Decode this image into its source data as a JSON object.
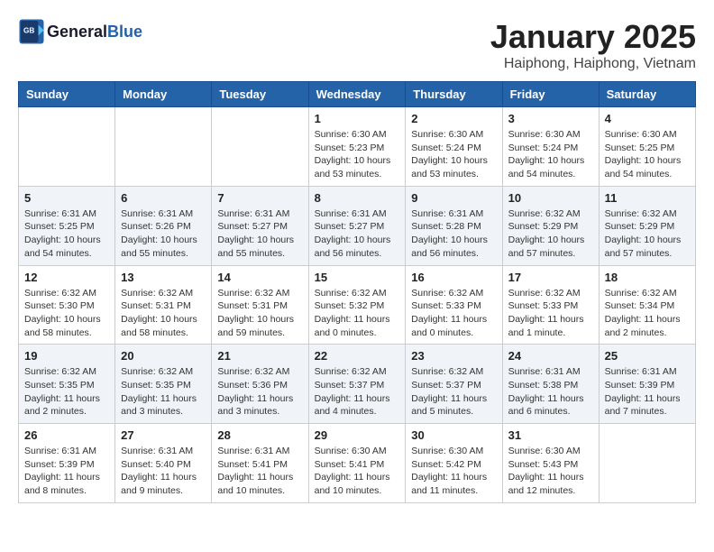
{
  "header": {
    "logo_line1": "General",
    "logo_line2": "Blue",
    "month": "January 2025",
    "location": "Haiphong, Haiphong, Vietnam"
  },
  "weekdays": [
    "Sunday",
    "Monday",
    "Tuesday",
    "Wednesday",
    "Thursday",
    "Friday",
    "Saturday"
  ],
  "weeks": [
    [
      {
        "day": "",
        "info": ""
      },
      {
        "day": "",
        "info": ""
      },
      {
        "day": "",
        "info": ""
      },
      {
        "day": "1",
        "info": "Sunrise: 6:30 AM\nSunset: 5:23 PM\nDaylight: 10 hours\nand 53 minutes."
      },
      {
        "day": "2",
        "info": "Sunrise: 6:30 AM\nSunset: 5:24 PM\nDaylight: 10 hours\nand 53 minutes."
      },
      {
        "day": "3",
        "info": "Sunrise: 6:30 AM\nSunset: 5:24 PM\nDaylight: 10 hours\nand 54 minutes."
      },
      {
        "day": "4",
        "info": "Sunrise: 6:30 AM\nSunset: 5:25 PM\nDaylight: 10 hours\nand 54 minutes."
      }
    ],
    [
      {
        "day": "5",
        "info": "Sunrise: 6:31 AM\nSunset: 5:25 PM\nDaylight: 10 hours\nand 54 minutes."
      },
      {
        "day": "6",
        "info": "Sunrise: 6:31 AM\nSunset: 5:26 PM\nDaylight: 10 hours\nand 55 minutes."
      },
      {
        "day": "7",
        "info": "Sunrise: 6:31 AM\nSunset: 5:27 PM\nDaylight: 10 hours\nand 55 minutes."
      },
      {
        "day": "8",
        "info": "Sunrise: 6:31 AM\nSunset: 5:27 PM\nDaylight: 10 hours\nand 56 minutes."
      },
      {
        "day": "9",
        "info": "Sunrise: 6:31 AM\nSunset: 5:28 PM\nDaylight: 10 hours\nand 56 minutes."
      },
      {
        "day": "10",
        "info": "Sunrise: 6:32 AM\nSunset: 5:29 PM\nDaylight: 10 hours\nand 57 minutes."
      },
      {
        "day": "11",
        "info": "Sunrise: 6:32 AM\nSunset: 5:29 PM\nDaylight: 10 hours\nand 57 minutes."
      }
    ],
    [
      {
        "day": "12",
        "info": "Sunrise: 6:32 AM\nSunset: 5:30 PM\nDaylight: 10 hours\nand 58 minutes."
      },
      {
        "day": "13",
        "info": "Sunrise: 6:32 AM\nSunset: 5:31 PM\nDaylight: 10 hours\nand 58 minutes."
      },
      {
        "day": "14",
        "info": "Sunrise: 6:32 AM\nSunset: 5:31 PM\nDaylight: 10 hours\nand 59 minutes."
      },
      {
        "day": "15",
        "info": "Sunrise: 6:32 AM\nSunset: 5:32 PM\nDaylight: 11 hours\nand 0 minutes."
      },
      {
        "day": "16",
        "info": "Sunrise: 6:32 AM\nSunset: 5:33 PM\nDaylight: 11 hours\nand 0 minutes."
      },
      {
        "day": "17",
        "info": "Sunrise: 6:32 AM\nSunset: 5:33 PM\nDaylight: 11 hours\nand 1 minute."
      },
      {
        "day": "18",
        "info": "Sunrise: 6:32 AM\nSunset: 5:34 PM\nDaylight: 11 hours\nand 2 minutes."
      }
    ],
    [
      {
        "day": "19",
        "info": "Sunrise: 6:32 AM\nSunset: 5:35 PM\nDaylight: 11 hours\nand 2 minutes."
      },
      {
        "day": "20",
        "info": "Sunrise: 6:32 AM\nSunset: 5:35 PM\nDaylight: 11 hours\nand 3 minutes."
      },
      {
        "day": "21",
        "info": "Sunrise: 6:32 AM\nSunset: 5:36 PM\nDaylight: 11 hours\nand 3 minutes."
      },
      {
        "day": "22",
        "info": "Sunrise: 6:32 AM\nSunset: 5:37 PM\nDaylight: 11 hours\nand 4 minutes."
      },
      {
        "day": "23",
        "info": "Sunrise: 6:32 AM\nSunset: 5:37 PM\nDaylight: 11 hours\nand 5 minutes."
      },
      {
        "day": "24",
        "info": "Sunrise: 6:31 AM\nSunset: 5:38 PM\nDaylight: 11 hours\nand 6 minutes."
      },
      {
        "day": "25",
        "info": "Sunrise: 6:31 AM\nSunset: 5:39 PM\nDaylight: 11 hours\nand 7 minutes."
      }
    ],
    [
      {
        "day": "26",
        "info": "Sunrise: 6:31 AM\nSunset: 5:39 PM\nDaylight: 11 hours\nand 8 minutes."
      },
      {
        "day": "27",
        "info": "Sunrise: 6:31 AM\nSunset: 5:40 PM\nDaylight: 11 hours\nand 9 minutes."
      },
      {
        "day": "28",
        "info": "Sunrise: 6:31 AM\nSunset: 5:41 PM\nDaylight: 11 hours\nand 10 minutes."
      },
      {
        "day": "29",
        "info": "Sunrise: 6:30 AM\nSunset: 5:41 PM\nDaylight: 11 hours\nand 10 minutes."
      },
      {
        "day": "30",
        "info": "Sunrise: 6:30 AM\nSunset: 5:42 PM\nDaylight: 11 hours\nand 11 minutes."
      },
      {
        "day": "31",
        "info": "Sunrise: 6:30 AM\nSunset: 5:43 PM\nDaylight: 11 hours\nand 12 minutes."
      },
      {
        "day": "",
        "info": ""
      }
    ]
  ]
}
